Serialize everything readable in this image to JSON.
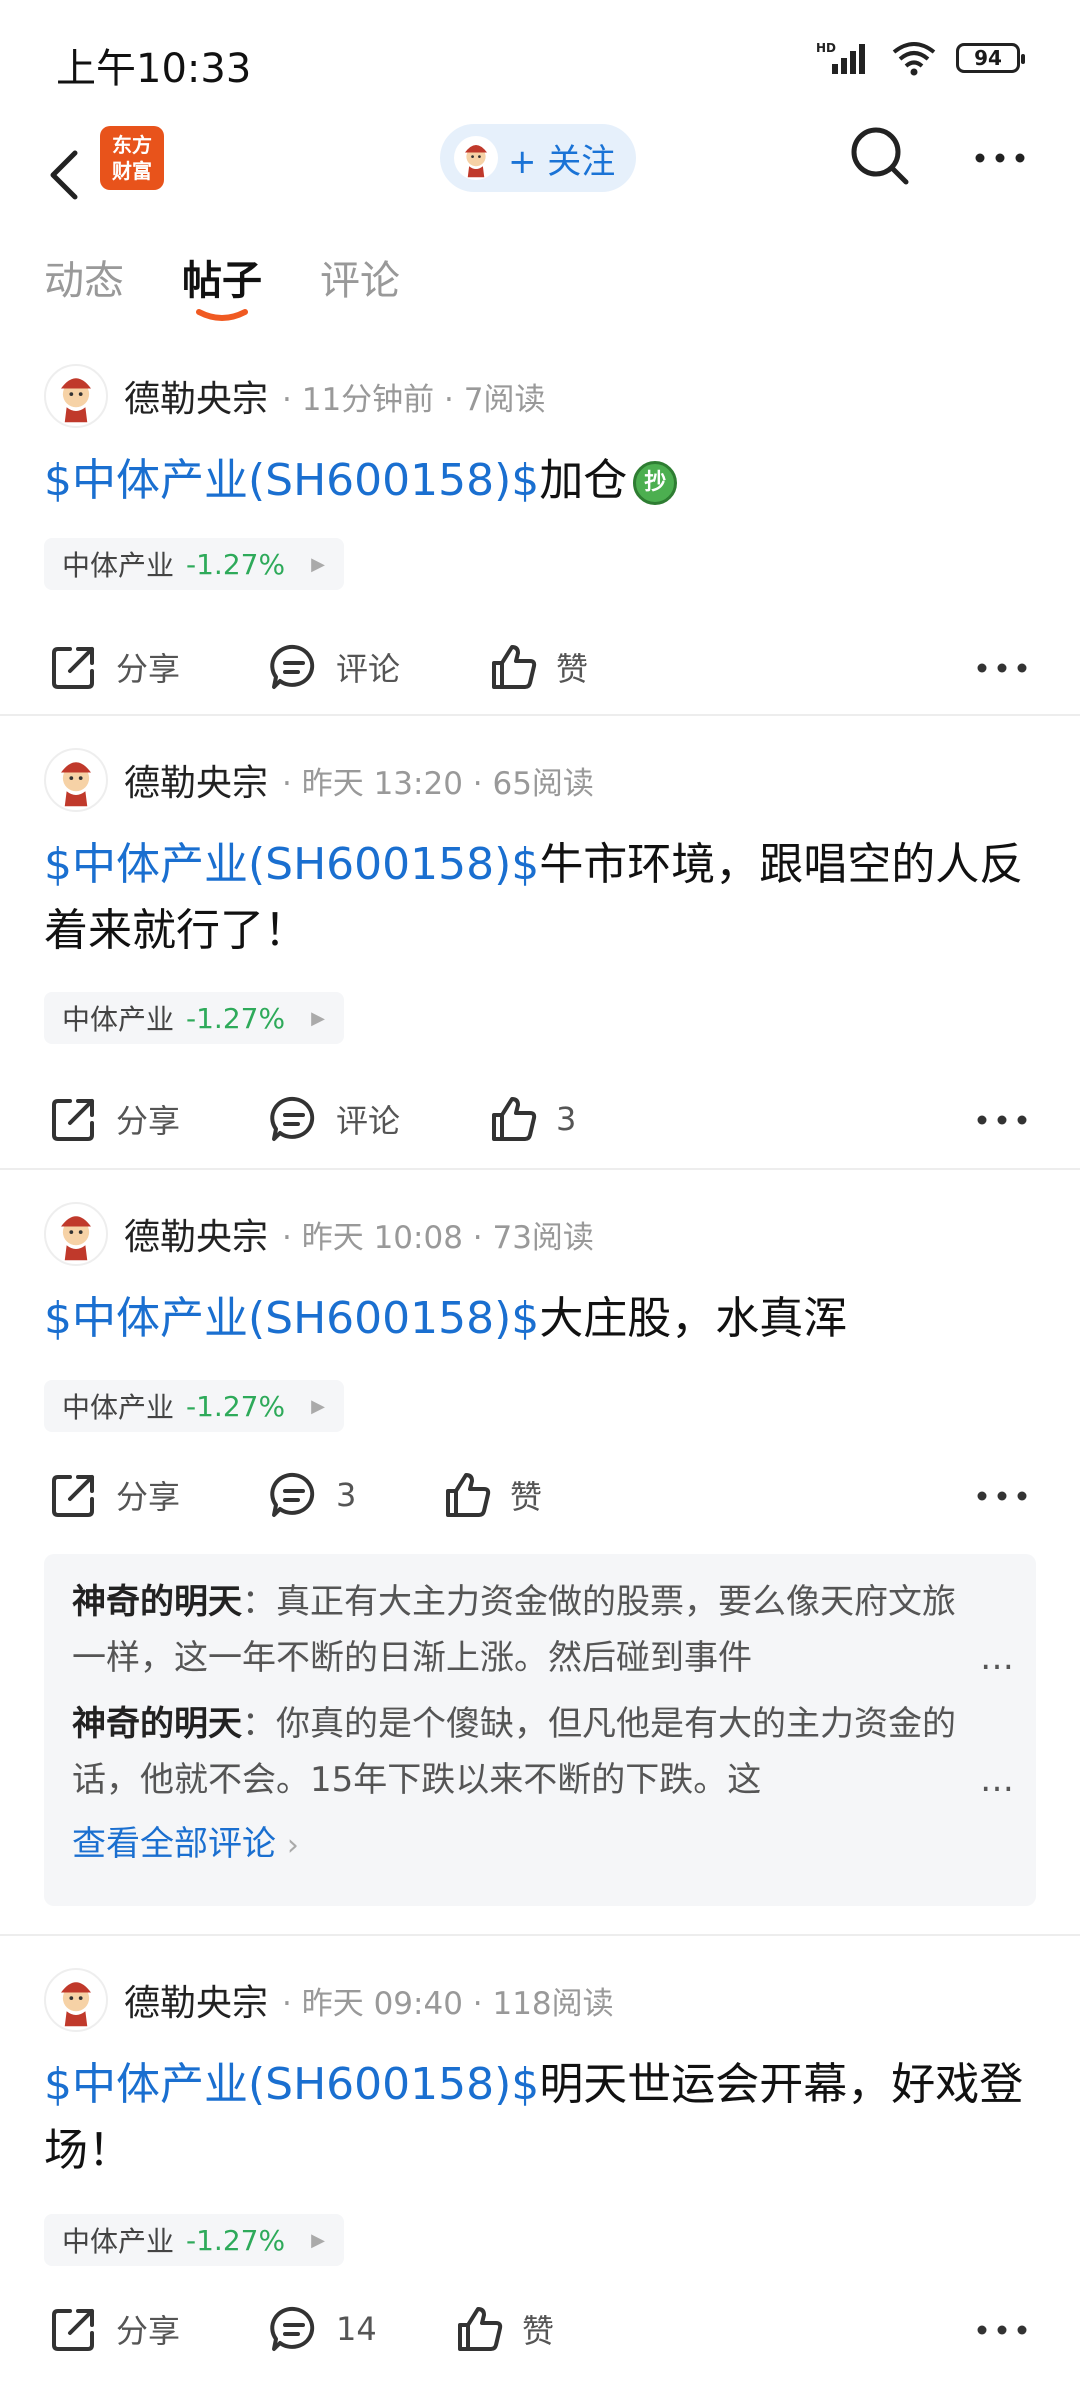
{
  "status": {
    "time": "上午10:33",
    "battery": "94",
    "network": "HD"
  },
  "header": {
    "logo_line1": "东方",
    "logo_line2": "财富",
    "follow_label": "+ 关注"
  },
  "tabs": [
    {
      "label": "动态"
    },
    {
      "label": "帖子"
    },
    {
      "label": "评论"
    }
  ],
  "posts": [
    {
      "author": "德勒央宗",
      "meta": "· 11分钟前 · 7阅读",
      "stock_link": "$中体产业(SH600158)$",
      "text": "加仓",
      "emoji": "抄",
      "tag_name": "中体产业",
      "tag_change": "-1.27%",
      "share": "分享",
      "comment": "评论",
      "like": "赞"
    },
    {
      "author": "德勒央宗",
      "meta": "· 昨天 13:20 · 65阅读",
      "stock_link": "$中体产业(SH600158)$",
      "text": "牛市环境，跟唱空的人反着来就行了！",
      "tag_name": "中体产业",
      "tag_change": "-1.27%",
      "share": "分享",
      "comment": "评论",
      "like": "3"
    },
    {
      "author": "德勒央宗",
      "meta": "· 昨天 10:08 · 73阅读",
      "stock_link": "$中体产业(SH600158)$",
      "text": "大庄股，水真浑",
      "tag_name": "中体产业",
      "tag_change": "-1.27%",
      "share": "分享",
      "comment": "3",
      "like": "赞",
      "comments": [
        {
          "name": "神奇的明天",
          "text": "：真正有大主力资金做的股票，要么像天府文旅一样，这一年不断的日渐上涨。然后碰到事件"
        },
        {
          "name": "神奇的明天",
          "text": "：你真的是个傻缺，但凡他是有大的主力资金的话，他就不会。15年下跌以来不断的下跌。这"
        }
      ],
      "view_all": "查看全部评论"
    },
    {
      "author": "德勒央宗",
      "meta": "· 昨天 09:40 · 118阅读",
      "stock_link": "$中体产业(SH600158)$",
      "text": "明天世运会开幕，好戏登场！",
      "tag_name": "中体产业",
      "tag_change": "-1.27%",
      "share": "分享",
      "comment": "14",
      "like": "赞"
    }
  ],
  "colors": {
    "accent": "#1a6fd0",
    "down": "#2eaa5a",
    "brand": "#e8531b"
  },
  "icons": [
    "back-icon",
    "search-icon",
    "more-icon",
    "share-icon",
    "comment-icon",
    "like-icon"
  ]
}
